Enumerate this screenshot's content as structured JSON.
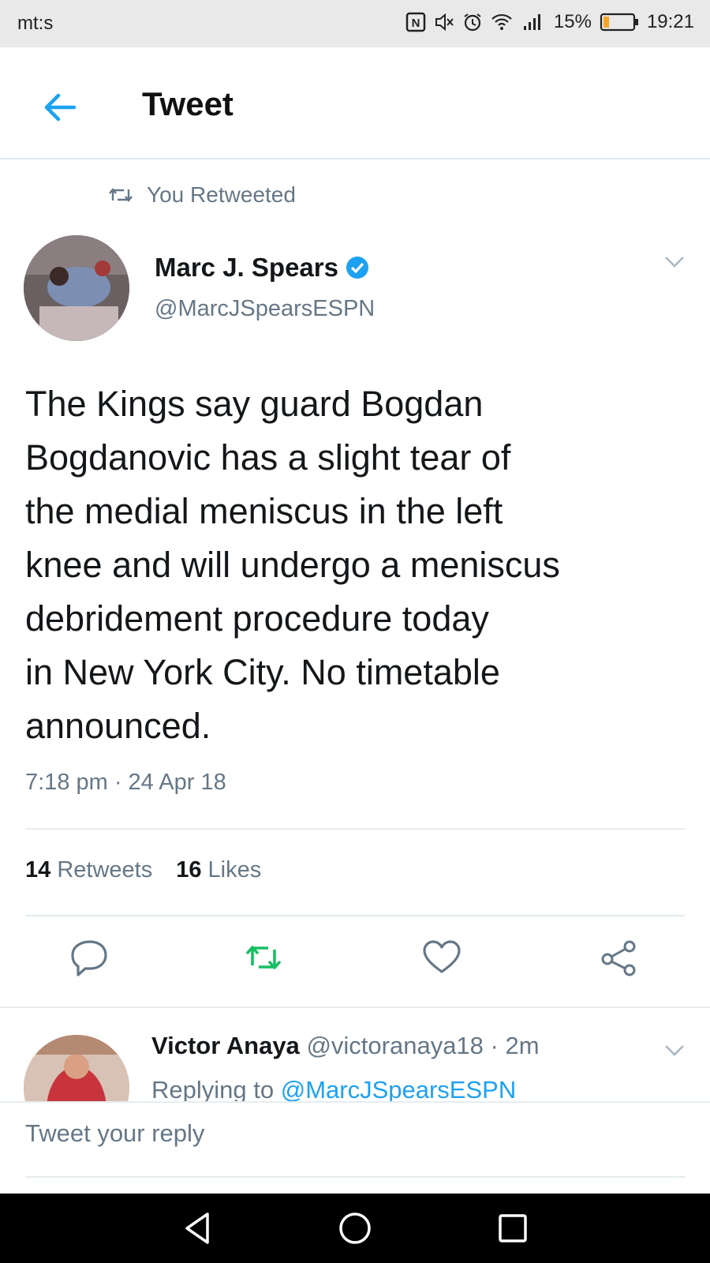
{
  "status": {
    "carrier": "mt:s",
    "battery": "15%",
    "time": "19:21"
  },
  "header": {
    "title": "Tweet"
  },
  "retweet_notice": "You Retweeted",
  "tweet": {
    "name": "Marc J. Spears",
    "handle": "@MarcJSpearsESPN",
    "text": "The Kings say guard Bogdan\nBogdanovic has a slight tear of\nthe medial meniscus in the left\nknee and will undergo a meniscus\ndebridement procedure today\nin New York City. No timetable\nannounced.",
    "timestamp": "7:18 pm · 24 Apr 18",
    "retweets_count": "14",
    "retweets_label": "Retweets",
    "likes_count": "16",
    "likes_label": "Likes"
  },
  "reply": {
    "name": "Victor Anaya",
    "handle_time": "@victoranaya18 · 2m",
    "replying_prefix": "Replying to",
    "replying_to": "@MarcJSpearsESPN"
  },
  "compose": {
    "placeholder": "Tweet your reply"
  },
  "colors": {
    "accent": "#1da1f2",
    "retweet_green": "#17bf63",
    "muted": "#657786"
  },
  "icons": [
    "nfc-icon",
    "mute-icon",
    "alarm-icon",
    "wifi-icon",
    "signal-icon",
    "battery-icon",
    "back-arrow-icon",
    "retweet-icon",
    "verified-icon",
    "chevron-down-icon",
    "reply-icon",
    "like-icon",
    "share-icon",
    "nav-back-icon",
    "nav-home-icon",
    "nav-recents-icon"
  ]
}
